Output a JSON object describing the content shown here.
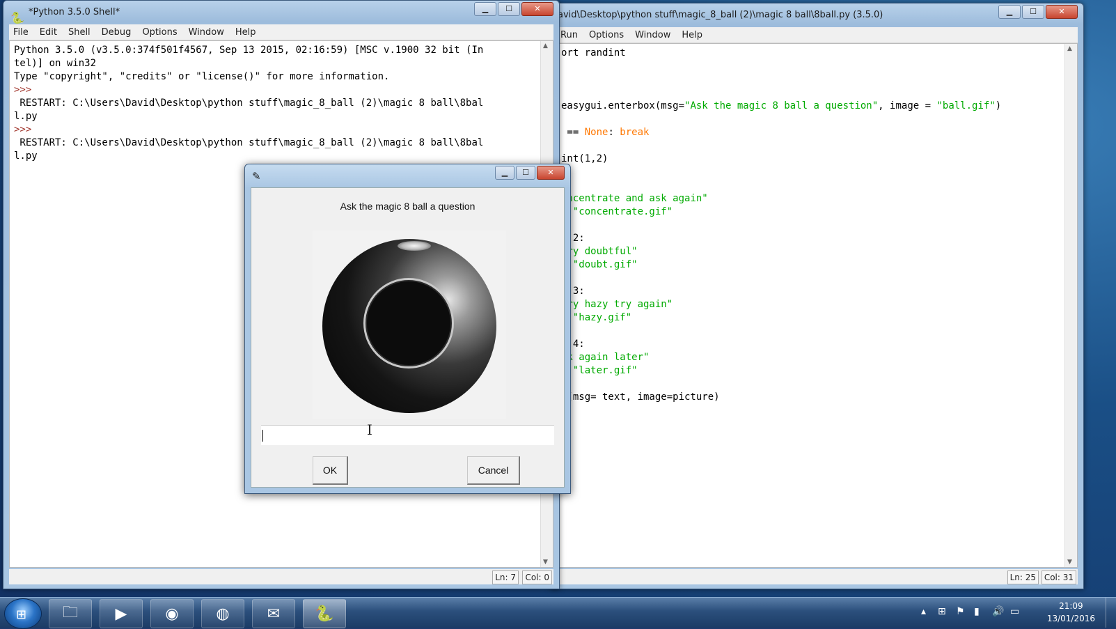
{
  "shell": {
    "title": "*Python 3.5.0 Shell*",
    "menu": [
      "File",
      "Edit",
      "Shell",
      "Debug",
      "Options",
      "Window",
      "Help"
    ],
    "lines": [
      "Python 3.5.0 (v3.5.0:374f501f4567, Sep 13 2015, 02:16:59) [MSC v.1900 32 bit (In",
      "tel)] on win32",
      "Type \"copyright\", \"credits\" or \"license()\" for more information.",
      ">>> ",
      " RESTART: C:\\Users\\David\\Desktop\\python stuff\\magic_8_ball (2)\\magic 8 ball\\8bal",
      "l.py",
      ">>> ",
      " RESTART: C:\\Users\\David\\Desktop\\python stuff\\magic_8_ball (2)\\magic 8 ball\\8bal",
      "l.py"
    ],
    "status_ln": "Ln: 7",
    "status_col": "Col: 0"
  },
  "editor": {
    "title": "avid\\Desktop\\python stuff\\magic_8_ball (2)\\magic 8 ball\\8ball.py (3.5.0)",
    "menu": [
      "Run",
      "Options",
      "Window",
      "Help"
    ],
    "code": [
      {
        "t": "ort randint",
        "c": ""
      },
      {
        "t": "",
        "c": ""
      },
      {
        "t": "",
        "c": ""
      },
      {
        "t": "",
        "c": ""
      },
      {
        "t": "easygui.enterbox(msg=\"Ask the magic 8 ball a question\", image = \"ball.gif\")",
        "c": "mixed1"
      },
      {
        "t": "",
        "c": ""
      },
      {
        "t": " == None: break",
        "c": "mixed2"
      },
      {
        "t": "",
        "c": ""
      },
      {
        "t": "int(1,2)",
        "c": ""
      },
      {
        "t": "",
        "c": ""
      },
      {
        "t": "1:",
        "c": ""
      },
      {
        "t": "oncentrate and ask again\"",
        "c": "str"
      },
      {
        "t": "  \"concentrate.gif\"",
        "c": "str"
      },
      {
        "t": "",
        "c": ""
      },
      {
        "t": "= 2:",
        "c": ""
      },
      {
        "t": "ery doubtful\"",
        "c": "str"
      },
      {
        "t": "  \"doubt.gif\"",
        "c": "str"
      },
      {
        "t": "",
        "c": ""
      },
      {
        "t": "= 3:",
        "c": ""
      },
      {
        "t": "ery hazy try again\"",
        "c": "str"
      },
      {
        "t": "  \"hazy.gif\"",
        "c": "str"
      },
      {
        "t": "",
        "c": ""
      },
      {
        "t": "= 4:",
        "c": ""
      },
      {
        "t": "sk again later\"",
        "c": "str"
      },
      {
        "t": "  \"later.gif\"",
        "c": "str"
      },
      {
        "t": "",
        "c": ""
      },
      {
        "t": "x(msg= text, image=picture)",
        "c": ""
      }
    ],
    "mixed1": {
      "a": "easygui.enterbox(msg=",
      "s1": "\"Ask the magic 8 ball a question\"",
      "b": ", image = ",
      "s2": "\"ball.gif\"",
      "c": ")"
    },
    "mixed2": {
      "a": " == ",
      "k": "None",
      "b": ": ",
      "k2": "break"
    },
    "status_ln": "Ln: 25",
    "status_col": "Col: 31"
  },
  "dialog": {
    "message": "Ask the magic 8 ball a question",
    "input_value": "",
    "ok_label": "OK",
    "cancel_label": "Cancel",
    "image_description": "magic 8 ball image"
  },
  "taskbar": {
    "apps": [
      "file-explorer-icon",
      "media-player-icon",
      "firefox-icon",
      "chrome-icon",
      "notepad-icon",
      "python-idle-icon"
    ],
    "time": "21:09",
    "date": "13/01/2016"
  }
}
